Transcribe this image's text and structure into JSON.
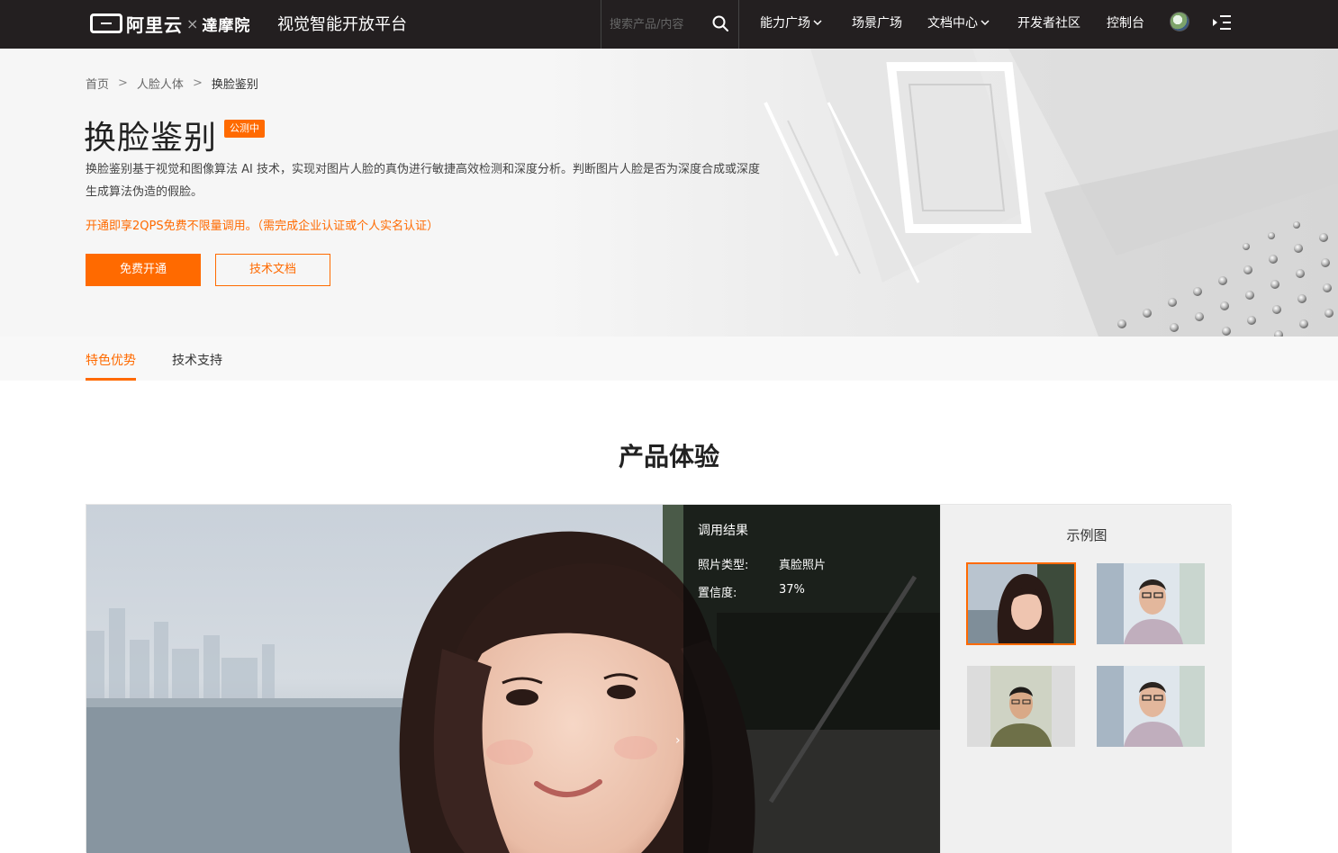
{
  "nav": {
    "brand_left": "阿里云",
    "brand_sep": "×",
    "brand_right": "達摩院",
    "platform": "视觉智能开放平台",
    "search_placeholder": "搜索产品/内容",
    "items": [
      {
        "label": "能力广场",
        "has_dropdown": true
      },
      {
        "label": "场景广场",
        "has_dropdown": false
      },
      {
        "label": "文档中心",
        "has_dropdown": true
      },
      {
        "label": "开发者社区",
        "has_dropdown": false
      },
      {
        "label": "控制台",
        "has_dropdown": false
      }
    ]
  },
  "breadcrumb": [
    "首页",
    "人脸人体",
    "换脸鉴别"
  ],
  "breadcrumb_sep": ">",
  "hero": {
    "title": "换脸鉴别",
    "badge": "公测中",
    "description": "换脸鉴别基于视觉和图像算法 AI 技术，实现对图片人脸的真伪进行敏捷高效检测和深度分析。判断图片人脸是否为深度合成或深度生成算法伪造的假脸。",
    "promo": "开通即享2QPS免费不限量调用。（需完成企业认证或个人实名认证）",
    "primary_button": "免费开通",
    "secondary_button": "技术文档"
  },
  "tabs": [
    {
      "label": "特色优势",
      "active": true
    },
    {
      "label": "技术支持",
      "active": false
    }
  ],
  "section_title": "产品体验",
  "result": {
    "title": "调用结果",
    "rows": [
      {
        "label": "照片类型:",
        "value": "真脸照片"
      },
      {
        "label": "置信度:",
        "value": "37%"
      }
    ],
    "arrow": "›"
  },
  "samples": {
    "title": "示例图",
    "selected_index": 0,
    "count": 4
  },
  "colors": {
    "accent": "#ff6a00",
    "nav_bg": "#231f20",
    "banner_bg": "#f6f6f6"
  }
}
